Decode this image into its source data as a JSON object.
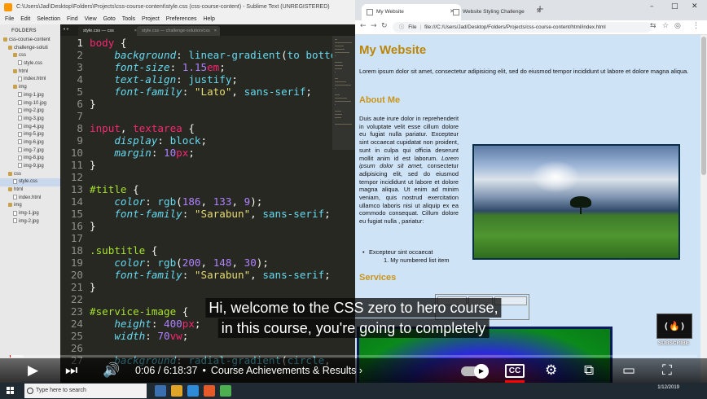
{
  "sublime": {
    "window_title": "C:\\Users\\Jad\\Desktop\\Folders\\Projects\\css-course-content\\style.css (css-course-content) - Sublime Text (UNREGISTERED)",
    "menu": [
      "File",
      "Edit",
      "Selection",
      "Find",
      "View",
      "Goto",
      "Tools",
      "Project",
      "Preferences",
      "Help"
    ],
    "sidebar_header": "FOLDERS",
    "tree": [
      {
        "label": "css-course-content",
        "type": "folder",
        "indent": 1
      },
      {
        "label": "challenge-soluti",
        "type": "folder",
        "indent": 2
      },
      {
        "label": "css",
        "type": "folder",
        "indent": 3
      },
      {
        "label": "style.css",
        "type": "file",
        "indent": 4
      },
      {
        "label": "html",
        "type": "folder",
        "indent": 3
      },
      {
        "label": "index.html",
        "type": "file",
        "indent": 4
      },
      {
        "label": "img",
        "type": "folder",
        "indent": 3
      },
      {
        "label": "img-1.jpg",
        "type": "file",
        "indent": 4
      },
      {
        "label": "img-10.jpg",
        "type": "file",
        "indent": 4
      },
      {
        "label": "img-2.jpg",
        "type": "file",
        "indent": 4
      },
      {
        "label": "img-3.jpg",
        "type": "file",
        "indent": 4
      },
      {
        "label": "img-4.jpg",
        "type": "file",
        "indent": 4
      },
      {
        "label": "img-5.jpg",
        "type": "file",
        "indent": 4
      },
      {
        "label": "img-6.jpg",
        "type": "file",
        "indent": 4
      },
      {
        "label": "img-7.jpg",
        "type": "file",
        "indent": 4
      },
      {
        "label": "img-8.jpg",
        "type": "file",
        "indent": 4
      },
      {
        "label": "img-9.jpg",
        "type": "file",
        "indent": 4
      },
      {
        "label": "css",
        "type": "folder",
        "indent": 2
      },
      {
        "label": "style.css",
        "type": "file",
        "indent": 3,
        "selected": true
      },
      {
        "label": "html",
        "type": "folder",
        "indent": 2
      },
      {
        "label": "index.html",
        "type": "file",
        "indent": 3
      },
      {
        "label": "img",
        "type": "folder",
        "indent": 2
      },
      {
        "label": "img-1.jpg",
        "type": "file",
        "indent": 3
      },
      {
        "label": "img-2.jpg",
        "type": "file",
        "indent": 3
      }
    ],
    "tabs": [
      {
        "label": "style.css — css",
        "active": true
      },
      {
        "label": "style.css — challenge-solution/css",
        "active": false
      }
    ],
    "code_lines": [
      {
        "n": "1",
        "tokens": [
          {
            "t": "body",
            "c": "k-sel"
          },
          {
            "t": " {",
            "c": "k-plain"
          }
        ]
      },
      {
        "n": "2",
        "tokens": [
          {
            "t": "    background",
            "c": "k-prop"
          },
          {
            "t": ": ",
            "c": "k-plain"
          },
          {
            "t": "linear-gradient",
            "c": "k-val"
          },
          {
            "t": "(",
            "c": "k-plain"
          },
          {
            "t": "to bottom",
            "c": "k-val"
          },
          {
            "t": ",",
            "c": "k-plain"
          }
        ]
      },
      {
        "n": "3",
        "tokens": [
          {
            "t": "    font-size",
            "c": "k-prop"
          },
          {
            "t": ": ",
            "c": "k-plain"
          },
          {
            "t": "1.15",
            "c": "k-num"
          },
          {
            "t": "em",
            "c": "k-unit"
          },
          {
            "t": ";",
            "c": "k-plain"
          }
        ]
      },
      {
        "n": "4",
        "tokens": [
          {
            "t": "    text-align",
            "c": "k-prop"
          },
          {
            "t": ": ",
            "c": "k-plain"
          },
          {
            "t": "justify",
            "c": "k-val"
          },
          {
            "t": ";",
            "c": "k-plain"
          }
        ]
      },
      {
        "n": "5",
        "tokens": [
          {
            "t": "    font-family",
            "c": "k-prop"
          },
          {
            "t": ": ",
            "c": "k-plain"
          },
          {
            "t": "\"Lato\"",
            "c": "k-str"
          },
          {
            "t": ", ",
            "c": "k-plain"
          },
          {
            "t": "sans-serif",
            "c": "k-val"
          },
          {
            "t": ";",
            "c": "k-plain"
          }
        ]
      },
      {
        "n": "6",
        "tokens": [
          {
            "t": "}",
            "c": "k-plain"
          }
        ]
      },
      {
        "n": "7",
        "tokens": []
      },
      {
        "n": "8",
        "tokens": [
          {
            "t": "input",
            "c": "k-sel"
          },
          {
            "t": ", ",
            "c": "k-plain"
          },
          {
            "t": "textarea",
            "c": "k-sel"
          },
          {
            "t": " {",
            "c": "k-plain"
          }
        ]
      },
      {
        "n": "9",
        "tokens": [
          {
            "t": "    display",
            "c": "k-prop"
          },
          {
            "t": ": ",
            "c": "k-plain"
          },
          {
            "t": "block",
            "c": "k-val"
          },
          {
            "t": ";",
            "c": "k-plain"
          }
        ]
      },
      {
        "n": "10",
        "tokens": [
          {
            "t": "    margin",
            "c": "k-prop"
          },
          {
            "t": ": ",
            "c": "k-plain"
          },
          {
            "t": "10",
            "c": "k-num"
          },
          {
            "t": "px",
            "c": "k-unit"
          },
          {
            "t": ";",
            "c": "k-plain"
          }
        ]
      },
      {
        "n": "11",
        "tokens": [
          {
            "t": "}",
            "c": "k-plain"
          }
        ]
      },
      {
        "n": "12",
        "tokens": []
      },
      {
        "n": "13",
        "tokens": [
          {
            "t": "#title",
            "c": "k-cls"
          },
          {
            "t": " {",
            "c": "k-plain"
          }
        ]
      },
      {
        "n": "14",
        "tokens": [
          {
            "t": "    color",
            "c": "k-prop"
          },
          {
            "t": ": ",
            "c": "k-plain"
          },
          {
            "t": "rgb",
            "c": "k-val"
          },
          {
            "t": "(",
            "c": "k-plain"
          },
          {
            "t": "186",
            "c": "k-num"
          },
          {
            "t": ", ",
            "c": "k-plain"
          },
          {
            "t": "133",
            "c": "k-num"
          },
          {
            "t": ", ",
            "c": "k-plain"
          },
          {
            "t": "9",
            "c": "k-num"
          },
          {
            "t": ");",
            "c": "k-plain"
          }
        ]
      },
      {
        "n": "15",
        "tokens": [
          {
            "t": "    font-family",
            "c": "k-prop"
          },
          {
            "t": ": ",
            "c": "k-plain"
          },
          {
            "t": "\"Sarabun\"",
            "c": "k-str"
          },
          {
            "t": ", ",
            "c": "k-plain"
          },
          {
            "t": "sans-serif",
            "c": "k-val"
          },
          {
            "t": ";",
            "c": "k-plain"
          }
        ]
      },
      {
        "n": "16",
        "tokens": [
          {
            "t": "}",
            "c": "k-plain"
          }
        ]
      },
      {
        "n": "17",
        "tokens": []
      },
      {
        "n": "18",
        "tokens": [
          {
            "t": ".subtitle",
            "c": "k-cls"
          },
          {
            "t": " {",
            "c": "k-plain"
          }
        ]
      },
      {
        "n": "19",
        "tokens": [
          {
            "t": "    color",
            "c": "k-prop"
          },
          {
            "t": ": ",
            "c": "k-plain"
          },
          {
            "t": "rgb",
            "c": "k-val"
          },
          {
            "t": "(",
            "c": "k-plain"
          },
          {
            "t": "200",
            "c": "k-num"
          },
          {
            "t": ", ",
            "c": "k-plain"
          },
          {
            "t": "148",
            "c": "k-num"
          },
          {
            "t": ", ",
            "c": "k-plain"
          },
          {
            "t": "30",
            "c": "k-num"
          },
          {
            "t": ");",
            "c": "k-plain"
          }
        ]
      },
      {
        "n": "20",
        "tokens": [
          {
            "t": "    font-family",
            "c": "k-prop"
          },
          {
            "t": ": ",
            "c": "k-plain"
          },
          {
            "t": "\"Sarabun\"",
            "c": "k-str"
          },
          {
            "t": ", ",
            "c": "k-plain"
          },
          {
            "t": "sans-serif",
            "c": "k-val"
          },
          {
            "t": ";",
            "c": "k-plain"
          }
        ]
      },
      {
        "n": "21",
        "tokens": [
          {
            "t": "}",
            "c": "k-plain"
          }
        ]
      },
      {
        "n": "22",
        "tokens": []
      },
      {
        "n": "23",
        "tokens": [
          {
            "t": "#service-image",
            "c": "k-cls"
          },
          {
            "t": " {",
            "c": "k-plain"
          }
        ]
      },
      {
        "n": "24",
        "tokens": [
          {
            "t": "    height",
            "c": "k-prop"
          },
          {
            "t": ": ",
            "c": "k-plain"
          },
          {
            "t": "400",
            "c": "k-num"
          },
          {
            "t": "px",
            "c": "k-unit"
          },
          {
            "t": ";",
            "c": "k-plain"
          }
        ]
      },
      {
        "n": "25",
        "tokens": [
          {
            "t": "    width",
            "c": "k-prop"
          },
          {
            "t": ": ",
            "c": "k-plain"
          },
          {
            "t": "70",
            "c": "k-num"
          },
          {
            "t": "vw",
            "c": "k-unit"
          },
          {
            "t": ";",
            "c": "k-plain"
          }
        ]
      },
      {
        "n": "26",
        "tokens": []
      },
      {
        "n": "27",
        "tokens": [
          {
            "t": "    background",
            "c": "k-prop"
          },
          {
            "t": ": ",
            "c": "k-plain"
          },
          {
            "t": "radial-gradient",
            "c": "k-val"
          },
          {
            "t": "(",
            "c": "k-plain"
          },
          {
            "t": "circle",
            "c": "k-val"
          },
          {
            "t": ", re",
            "c": "k-plain"
          }
        ]
      }
    ],
    "current_line": "1"
  },
  "browser": {
    "tabs": [
      {
        "label": "My Website",
        "active": true
      },
      {
        "label": "Website Styling Challenge",
        "active": false
      }
    ],
    "address_scheme": "File",
    "address_url": "file:///C:/Users/Jad/Desktop/Folders/Projects/css-course-content/html/index.html",
    "page": {
      "title": "My Website",
      "intro": "Lorem ipsum dolor sit amet, consectetur adipisicing elit, sed do eiusmod tempor incididunt ut labore et dolore magna aliqua.",
      "about_heading": "About Me",
      "about_text_a": "Duis aute irure dolor in reprehenderit in voluptate velit esse cillum dolore eu fugiat nulla pariatur. Excepteur sint occaecat cupidatat non proident, sunt in culpa qui officia deserunt mollit anim id est laborum. ",
      "about_text_em": "Lorem ipsum dolor sit amet,",
      "about_text_b": " consectetur adipisicing elit, sed do eiusmod tempor incididunt ut labore et dolore magna aliqua. Ut enim ad minim veniam, quis nostrud exercitation ullamco laboris nisi ut aliquip ex ea commodo consequat. Cillum dolore eu fugiat nulla , pariatur:",
      "list_item": "Excepteur sint occaecat",
      "sub_list_item": "1. My numbered list item",
      "services_heading": "Services"
    }
  },
  "youtube": {
    "caption_line1": "Hi, welcome to the CSS zero to hero course,",
    "caption_line2": "in this course, you're going to completely",
    "time_current": "0:06",
    "time_total": "6:18:37",
    "chapter": "Course Achievements & Results",
    "progress_played": 0.0016,
    "progress_loaded": 0.02,
    "subscribe_label": "SUBSCRIBE",
    "accent_color": "#ff0000"
  },
  "taskbar": {
    "search_placeholder": "Type here to search",
    "date": "1/12/2019"
  }
}
